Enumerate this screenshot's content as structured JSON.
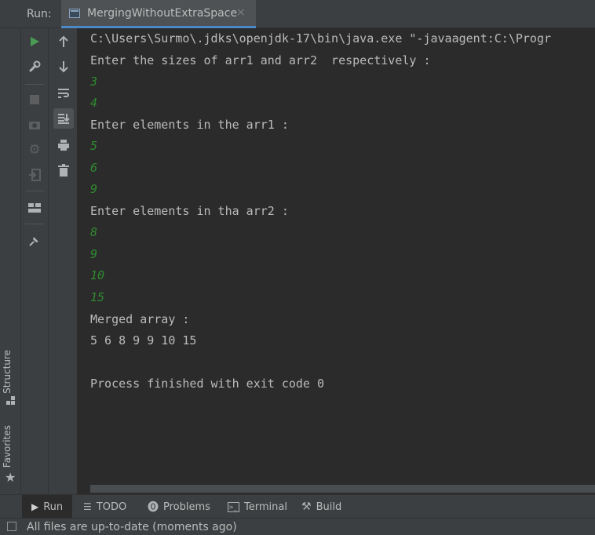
{
  "run_bar": {
    "label": "Run:",
    "tab_title": "MergingWithoutExtraSpace",
    "tab_close": "×"
  },
  "left_stripe": {
    "structure_label": "Structure",
    "favorites_label": "Favorites"
  },
  "console": {
    "lines": [
      {
        "text": "C:\\Users\\Surmo\\.jdks\\openjdk-17\\bin\\java.exe \"-javaagent:C:\\Progr",
        "type": "output"
      },
      {
        "text": "Enter the sizes of arr1 and arr2  respectively :",
        "type": "output"
      },
      {
        "text": "3",
        "type": "input"
      },
      {
        "text": "4",
        "type": "input"
      },
      {
        "text": "Enter elements in the arr1 :",
        "type": "output"
      },
      {
        "text": "5",
        "type": "input"
      },
      {
        "text": "6",
        "type": "input"
      },
      {
        "text": "9",
        "type": "input"
      },
      {
        "text": "Enter elements in tha arr2 :",
        "type": "output"
      },
      {
        "text": "8",
        "type": "input"
      },
      {
        "text": "9",
        "type": "input"
      },
      {
        "text": "10",
        "type": "input"
      },
      {
        "text": "15",
        "type": "input"
      },
      {
        "text": "Merged array :",
        "type": "output"
      },
      {
        "text": "5 6 8 9 9 10 15",
        "type": "output"
      },
      {
        "text": "",
        "type": "output"
      },
      {
        "text": "Process finished with exit code 0",
        "type": "output"
      }
    ]
  },
  "bottom_tabs": {
    "run": "Run",
    "todo": "TODO",
    "problems": "Problems",
    "terminal": "Terminal",
    "build": "Build"
  },
  "status": {
    "text": "All files are up-to-date (moments ago)"
  },
  "colors": {
    "background": "#2b2b2b",
    "panel": "#3c3f41",
    "input_text": "#2f8a2f",
    "output_text": "#bbbbbb",
    "accent": "#4a88c7",
    "run_green": "#499c54"
  }
}
